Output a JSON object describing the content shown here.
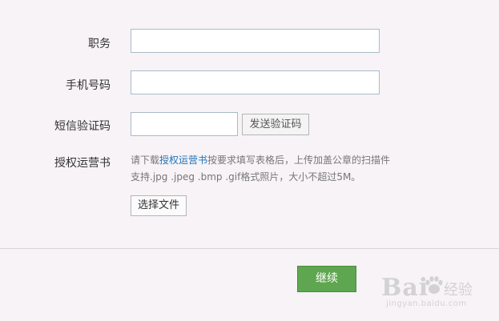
{
  "form": {
    "position_label": "职务",
    "phone_label": "手机号码",
    "sms_label": "短信验证码",
    "sms_button": "发送验证码",
    "authorization_label": "授权运营书",
    "note_prefix": "请下载",
    "note_link": "授权运营书",
    "note_suffix": "按要求填写表格后，上传加盖公章的扫描件",
    "note_line2": "支持.jpg .jpeg .bmp .gif格式照片，大小不超过5M。",
    "choose_file_button": "选择文件",
    "continue_button": "继续"
  },
  "watermark": {
    "logo": "Bai",
    "logo_tail": "u",
    "cn": "经验",
    "url": "jingyan.baidu.com"
  },
  "colors": {
    "background": "#f7f3f6",
    "continue_button": "#5ea64f",
    "link": "#1f72b8",
    "input_border": "#a9bcc6"
  }
}
